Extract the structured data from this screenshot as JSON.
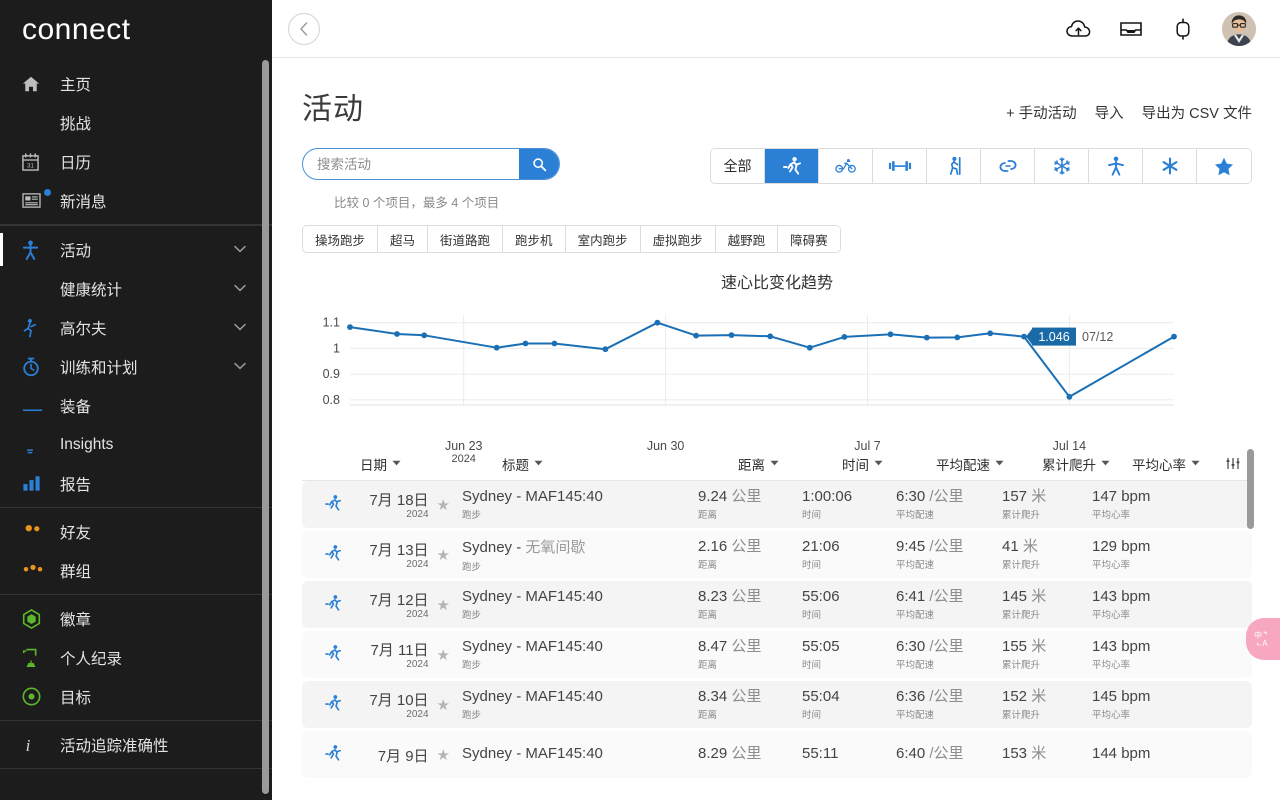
{
  "sidebar": {
    "brand": "connect",
    "groups": [
      {
        "items": [
          {
            "label": "主页",
            "icon": "home-icon",
            "color": "#bdbdbd",
            "chevron": false,
            "badge": false
          },
          {
            "label": "挑战",
            "icon": "wave-icon",
            "color": "#bdbdbd",
            "chevron": false,
            "badge": false
          },
          {
            "label": "日历",
            "icon": "calendar-icon",
            "color": "#bdbdbd",
            "chevron": false,
            "badge": false
          },
          {
            "label": "新消息",
            "icon": "news-icon",
            "color": "#bdbdbd",
            "chevron": false,
            "badge": true
          }
        ]
      },
      {
        "items": [
          {
            "label": "活动",
            "icon": "activity-icon",
            "color": "#2b7fd4",
            "chevron": true,
            "active": true
          },
          {
            "label": "健康统计",
            "icon": "heart-icon",
            "color": "#2b7fd4",
            "chevron": true
          },
          {
            "label": "高尔夫",
            "icon": "golf-icon",
            "color": "#2b7fd4",
            "chevron": true
          },
          {
            "label": "训练和计划",
            "icon": "stopwatch-icon",
            "color": "#2b7fd4",
            "chevron": true
          },
          {
            "label": "装备",
            "icon": "shoe-icon",
            "color": "#2b7fd4",
            "chevron": false
          },
          {
            "label": "Insights",
            "icon": "bulb-icon",
            "color": "#2b7fd4",
            "chevron": false
          },
          {
            "label": "报告",
            "icon": "bar-chart-icon",
            "color": "#2b7fd4",
            "chevron": false
          }
        ]
      },
      {
        "items": [
          {
            "label": "好友",
            "icon": "friends-icon",
            "color": "#e8921f",
            "chevron": false
          },
          {
            "label": "群组",
            "icon": "groups-icon",
            "color": "#e8921f",
            "chevron": false
          }
        ]
      },
      {
        "items": [
          {
            "label": "徽章",
            "icon": "badge-icon",
            "color": "#5cb82a",
            "chevron": false
          },
          {
            "label": "个人纪录",
            "icon": "trophy-icon",
            "color": "#5cb82a",
            "chevron": false
          },
          {
            "label": "目标",
            "icon": "target-icon",
            "color": "#5cb82a",
            "chevron": false
          }
        ]
      },
      {
        "items": [
          {
            "label": "活动追踪准确性",
            "icon": "info-icon",
            "color": "#d8d8d8",
            "chevron": false
          }
        ]
      }
    ]
  },
  "topbar": {
    "back_label": "‹",
    "icons": [
      {
        "name": "cloud-upload-icon"
      },
      {
        "name": "inbox-icon"
      },
      {
        "name": "watch-icon"
      }
    ],
    "avatar_name": "user-avatar"
  },
  "page": {
    "title": "活动",
    "actions": [
      {
        "label": "+ 手动活动",
        "name": "manual-activity-button"
      },
      {
        "label": "导入",
        "name": "import-button"
      },
      {
        "label": "导出为 CSV 文件",
        "name": "export-csv-button"
      }
    ]
  },
  "search": {
    "placeholder": "搜索活动",
    "value": "",
    "icon": "search-icon"
  },
  "compare_note": "比较 0 个项目，最多 4 个项目",
  "sport_tabs": [
    {
      "label": "全部",
      "icon": "",
      "selected": false,
      "name": "sport-tab-all"
    },
    {
      "label": "",
      "icon": "running-icon",
      "selected": true,
      "name": "sport-tab-running"
    },
    {
      "label": "",
      "icon": "cycling-icon",
      "selected": false,
      "name": "sport-tab-cycling"
    },
    {
      "label": "",
      "icon": "strength-icon",
      "selected": false,
      "name": "sport-tab-strength"
    },
    {
      "label": "",
      "icon": "hiking-icon",
      "selected": false,
      "name": "sport-tab-hiking"
    },
    {
      "label": "",
      "icon": "multisport-icon",
      "selected": false,
      "name": "sport-tab-multisport"
    },
    {
      "label": "",
      "icon": "snowflake-icon",
      "selected": false,
      "name": "sport-tab-winter"
    },
    {
      "label": "",
      "icon": "fitness-icon",
      "selected": false,
      "name": "sport-tab-fitness"
    },
    {
      "label": "",
      "icon": "asterisk-icon",
      "selected": false,
      "name": "sport-tab-other"
    },
    {
      "label": "",
      "icon": "star-icon",
      "selected": false,
      "name": "sport-tab-favorites"
    }
  ],
  "sub_tabs": [
    "操场跑步",
    "超马",
    "街道路跑",
    "跑步机",
    "室内跑步",
    "虚拟跑步",
    "越野跑",
    "障碍赛"
  ],
  "chart_data": {
    "type": "line",
    "title": "速心比变化趋势",
    "xlabel": "",
    "ylabel": "",
    "ylim": [
      0.78,
      1.13
    ],
    "yticks": [
      0.8,
      0.9,
      1,
      1.1
    ],
    "ytick_labels": [
      "0.8",
      "0.9",
      "1",
      "1.1"
    ],
    "grid": true,
    "legend": false,
    "line_color": "#1a6fb5",
    "xticks": [
      "Jun 23",
      "Jun 30",
      "Jul 7",
      "Jul 14"
    ],
    "xtick_sub": [
      "2024",
      "",
      "",
      ""
    ],
    "x_axis_start": "Jun 20",
    "x_axis_end": "Jul 19",
    "tooltip": {
      "value": "1.046",
      "date": "07/12"
    },
    "points": [
      {
        "x": 0.0,
        "y": 1.083
      },
      {
        "x": 0.057,
        "y": 1.056
      },
      {
        "x": 0.09,
        "y": 1.051
      },
      {
        "x": 0.178,
        "y": 1.003
      },
      {
        "x": 0.213,
        "y": 1.019
      },
      {
        "x": 0.248,
        "y": 1.019
      },
      {
        "x": 0.31,
        "y": 0.997
      },
      {
        "x": 0.373,
        "y": 1.1
      },
      {
        "x": 0.42,
        "y": 1.05
      },
      {
        "x": 0.463,
        "y": 1.052
      },
      {
        "x": 0.51,
        "y": 1.047
      },
      {
        "x": 0.558,
        "y": 1.003
      },
      {
        "x": 0.6,
        "y": 1.045
      },
      {
        "x": 0.656,
        "y": 1.055
      },
      {
        "x": 0.7,
        "y": 1.042
      },
      {
        "x": 0.737,
        "y": 1.043
      },
      {
        "x": 0.777,
        "y": 1.059
      },
      {
        "x": 0.818,
        "y": 1.046
      },
      {
        "x": 0.873,
        "y": 0.812
      },
      {
        "x": 1.0,
        "y": 1.046
      }
    ]
  },
  "table": {
    "columns": [
      {
        "key": "date",
        "label": "日期",
        "sortable": true
      },
      {
        "key": "title",
        "label": "标题",
        "sortable": true
      },
      {
        "key": "distance",
        "label": "距离",
        "sortable": true
      },
      {
        "key": "time",
        "label": "时间",
        "sortable": true
      },
      {
        "key": "pace",
        "label": "平均配速",
        "sortable": true
      },
      {
        "key": "elevation",
        "label": "累计爬升",
        "sortable": true
      },
      {
        "key": "hr",
        "label": "平均心率",
        "sortable": true
      }
    ],
    "settings_icon": "column-settings-icon",
    "rows": [
      {
        "sport_icon": "running-icon",
        "date": "7月 18日",
        "year": "2024",
        "starred": false,
        "title": "Sydney - MAF145:40",
        "title_muted": "",
        "subtitle": "跑步",
        "distance": "9.24",
        "distance_unit": "公里",
        "distance_key": "距离",
        "time": "1:00:06",
        "time_key": "时间",
        "pace": "6:30",
        "pace_unit": "/公里",
        "pace_key": "平均配速",
        "elevation": "157",
        "elevation_unit": "米",
        "elevation_key": "累计爬升",
        "hr": "147 bpm",
        "hr_key": "平均心率"
      },
      {
        "sport_icon": "running-icon",
        "date": "7月 13日",
        "year": "2024",
        "starred": false,
        "title": "Sydney - ",
        "title_muted": "无氧间歇",
        "subtitle": "跑步",
        "distance": "2.16",
        "distance_unit": "公里",
        "distance_key": "距离",
        "time": "21:06",
        "time_key": "时间",
        "pace": "9:45",
        "pace_unit": "/公里",
        "pace_key": "平均配速",
        "elevation": "41",
        "elevation_unit": "米",
        "elevation_key": "累计爬升",
        "hr": "129 bpm",
        "hr_key": "平均心率"
      },
      {
        "sport_icon": "running-icon",
        "date": "7月 12日",
        "year": "2024",
        "starred": false,
        "title": "Sydney - MAF145:40",
        "title_muted": "",
        "subtitle": "跑步",
        "distance": "8.23",
        "distance_unit": "公里",
        "distance_key": "距离",
        "time": "55:06",
        "time_key": "时间",
        "pace": "6:41",
        "pace_unit": "/公里",
        "pace_key": "平均配速",
        "elevation": "145",
        "elevation_unit": "米",
        "elevation_key": "累计爬升",
        "hr": "143 bpm",
        "hr_key": "平均心率"
      },
      {
        "sport_icon": "running-icon",
        "date": "7月 11日",
        "year": "2024",
        "starred": false,
        "title": "Sydney - MAF145:40",
        "title_muted": "",
        "subtitle": "跑步",
        "distance": "8.47",
        "distance_unit": "公里",
        "distance_key": "距离",
        "time": "55:05",
        "time_key": "时间",
        "pace": "6:30",
        "pace_unit": "/公里",
        "pace_key": "平均配速",
        "elevation": "155",
        "elevation_unit": "米",
        "elevation_key": "累计爬升",
        "hr": "143 bpm",
        "hr_key": "平均心率"
      },
      {
        "sport_icon": "running-icon",
        "date": "7月 10日",
        "year": "2024",
        "starred": false,
        "title": "Sydney - MAF145:40",
        "title_muted": "",
        "subtitle": "跑步",
        "distance": "8.34",
        "distance_unit": "公里",
        "distance_key": "距离",
        "time": "55:04",
        "time_key": "时间",
        "pace": "6:36",
        "pace_unit": "/公里",
        "pace_key": "平均配速",
        "elevation": "152",
        "elevation_unit": "米",
        "elevation_key": "累计爬升",
        "hr": "145 bpm",
        "hr_key": "平均心率"
      },
      {
        "sport_icon": "running-icon",
        "date": "7月 9日",
        "year": "",
        "starred": false,
        "title": "Sydney - MAF145:40",
        "title_muted": "",
        "subtitle": "",
        "distance": "8.29",
        "distance_unit": "公里",
        "distance_key": "",
        "time": "55:11",
        "time_key": "",
        "pace": "6:40",
        "pace_unit": "/公里",
        "pace_key": "",
        "elevation": "153",
        "elevation_unit": "米",
        "elevation_key": "",
        "hr": "144 bpm",
        "hr_key": ""
      }
    ]
  },
  "translate_fab": {
    "label": "中A",
    "name": "translate-button"
  }
}
